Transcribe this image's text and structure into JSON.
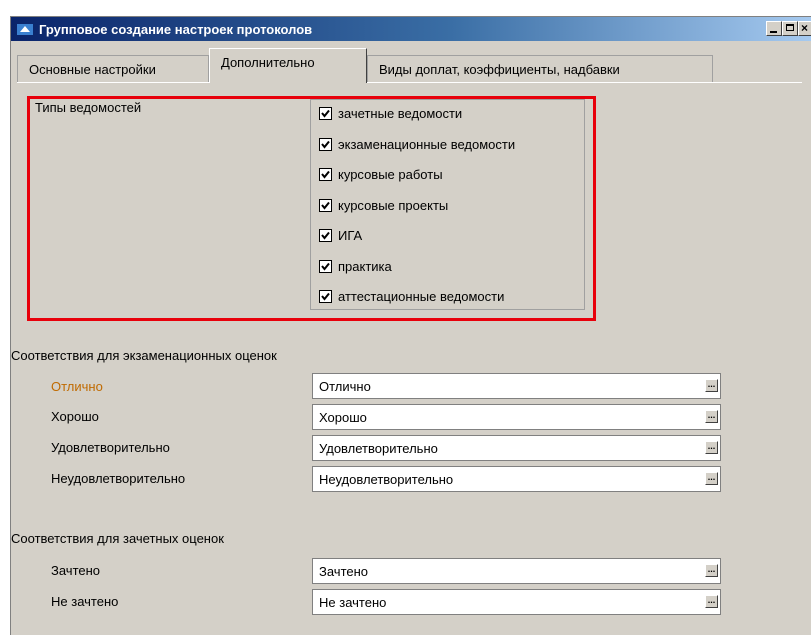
{
  "window": {
    "title": "Групповое создание настроек протоколов"
  },
  "tabs": [
    {
      "label": "Основные настройки"
    },
    {
      "label": "Дополнительно"
    },
    {
      "label": "Виды доплат, коэффициенты, надбавки"
    }
  ],
  "types": {
    "label": "Типы ведомостей",
    "items": [
      {
        "label": "зачетные ведомости",
        "checked": true
      },
      {
        "label": "экзаменационные ведомости",
        "checked": true
      },
      {
        "label": "курсовые работы",
        "checked": true
      },
      {
        "label": "курсовые проекты",
        "checked": true
      },
      {
        "label": "ИГА",
        "checked": true
      },
      {
        "label": "практика",
        "checked": true
      },
      {
        "label": "аттестационные ведомости",
        "checked": true
      }
    ]
  },
  "exam": {
    "label": "Соответствия для экзаменационных оценок",
    "rows": [
      {
        "label": "Отлично",
        "value": "Отлично"
      },
      {
        "label": "Хорошо",
        "value": "Хорошо"
      },
      {
        "label": "Удовлетворительно",
        "value": "Удовлетворительно"
      },
      {
        "label": "Неудовлетворительно",
        "value": "Неудовлетворительно"
      }
    ]
  },
  "credit": {
    "label": "Соответствия для зачетных оценок",
    "rows": [
      {
        "label": "Зачтено",
        "value": "Зачтено"
      },
      {
        "label": "Не зачтено",
        "value": "Не зачтено"
      }
    ]
  },
  "ellipsis": "...",
  "colors": {
    "highlight": "#e8000b",
    "active_label": "#c06a00",
    "titlebar": "#0a246a"
  }
}
